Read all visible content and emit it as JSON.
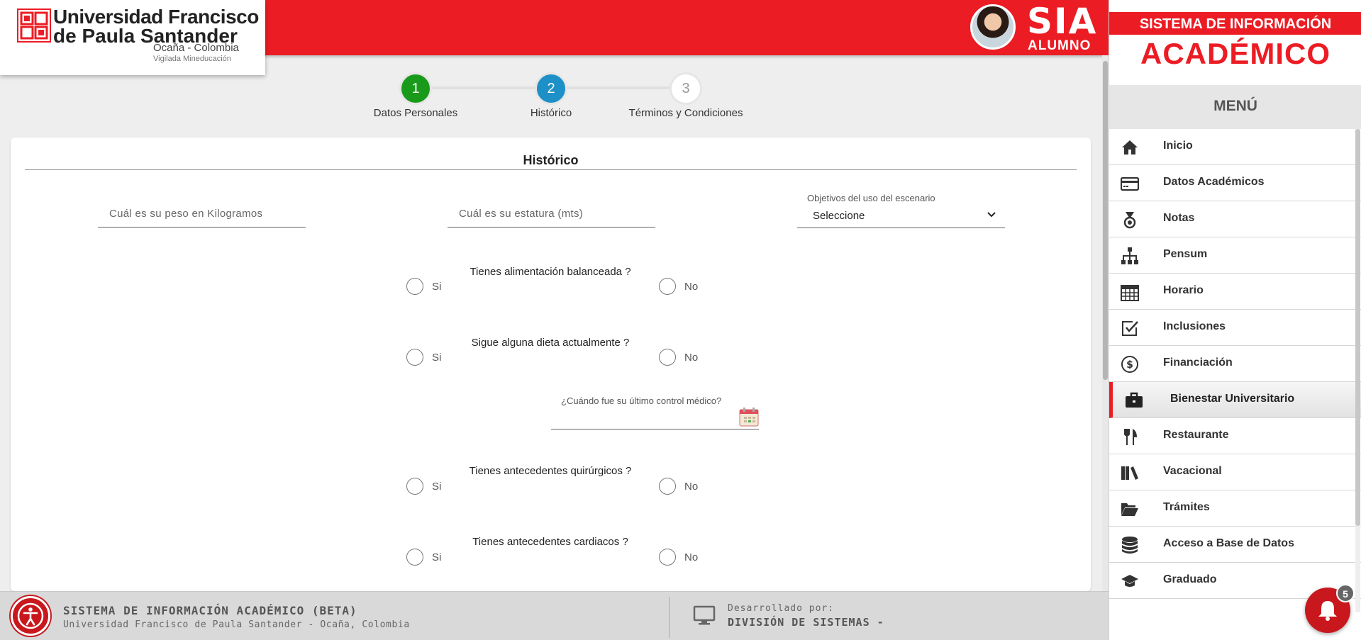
{
  "header": {
    "university_line1": "Universidad Francisco",
    "university_line2": "de Paula Santander",
    "university_line3": "Ocaña - Colombia",
    "university_line4": "Vigilada Mineducación",
    "app_name": "SIA",
    "app_role": "ALUMNO",
    "brand_color": "#ec1c24"
  },
  "steps": [
    {
      "number": "1",
      "label": "Datos Personales",
      "state": "completed",
      "color": "#1a9a1a"
    },
    {
      "number": "2",
      "label": "Histórico",
      "state": "current",
      "color": "#1e90c8"
    },
    {
      "number": "3",
      "label": "Términos y Condiciones",
      "state": "pending",
      "color": "#ffffff"
    }
  ],
  "form": {
    "title": "Histórico",
    "weight_placeholder": "Cuál es su peso en Kilogramos",
    "height_placeholder": "Cuál es su estatura (mts)",
    "objective_label": "Objetivos del uso del escenario",
    "objective_value": "Seleccione",
    "yes_label": "Si",
    "no_label": "No",
    "questions": [
      "Tienes alimentación balanceada ?",
      "Sigue alguna dieta actualmente ?",
      "Tienes antecedentes quirúrgicos ?",
      "Tienes antecedentes cardiacos ?"
    ],
    "date_label": "¿Cuándo fue su último control médico?"
  },
  "footer": {
    "title": "SISTEMA DE INFORMACIÓN ACADÉMICO (BETA)",
    "subtitle": "Universidad Francisco de Paula Santander - Ocaña, Colombia",
    "developed_by": "Desarrollado por:",
    "developer": "DIVISIÓN DE SISTEMAS -"
  },
  "sidebar": {
    "brand_line1": "SISTEMA DE INFORMACIÓN",
    "brand_line2": "ACADÉMICO",
    "menu_title": "MENÚ",
    "items": [
      {
        "label": "Inicio",
        "icon": "home-icon"
      },
      {
        "label": "Datos Académicos",
        "icon": "credit-card-icon"
      },
      {
        "label": "Notas",
        "icon": "medal-icon"
      },
      {
        "label": "Pensum",
        "icon": "sitemap-icon"
      },
      {
        "label": "Horario",
        "icon": "calendar-icon"
      },
      {
        "label": "Inclusiones",
        "icon": "check-square-icon"
      },
      {
        "label": "Financiación",
        "icon": "dollar-circle-icon"
      },
      {
        "label": "Bienestar Universitario",
        "icon": "briefcase-icon",
        "active": true
      },
      {
        "label": "Restaurante",
        "icon": "utensils-icon"
      },
      {
        "label": "Vacacional",
        "icon": "books-icon"
      },
      {
        "label": "Trámites",
        "icon": "folder-open-icon"
      },
      {
        "label": "Acceso a Base de Datos",
        "icon": "database-icon"
      },
      {
        "label": "Graduado",
        "icon": "graduation-cap-icon"
      }
    ]
  },
  "notifications": {
    "count": "5"
  }
}
